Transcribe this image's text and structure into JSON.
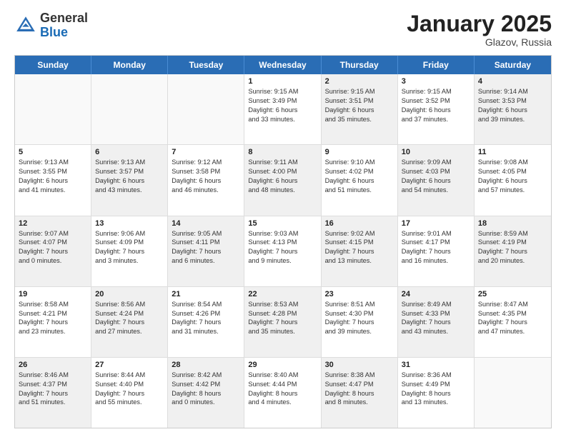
{
  "header": {
    "logo_general": "General",
    "logo_blue": "Blue",
    "title": "January 2025",
    "location": "Glazov, Russia"
  },
  "days_of_week": [
    "Sunday",
    "Monday",
    "Tuesday",
    "Wednesday",
    "Thursday",
    "Friday",
    "Saturday"
  ],
  "weeks": [
    [
      {
        "day": "",
        "lines": [],
        "empty": true
      },
      {
        "day": "",
        "lines": [],
        "empty": true
      },
      {
        "day": "",
        "lines": [],
        "empty": true
      },
      {
        "day": "1",
        "lines": [
          "Sunrise: 9:15 AM",
          "Sunset: 3:49 PM",
          "Daylight: 6 hours",
          "and 33 minutes."
        ],
        "shaded": false
      },
      {
        "day": "2",
        "lines": [
          "Sunrise: 9:15 AM",
          "Sunset: 3:51 PM",
          "Daylight: 6 hours",
          "and 35 minutes."
        ],
        "shaded": true
      },
      {
        "day": "3",
        "lines": [
          "Sunrise: 9:15 AM",
          "Sunset: 3:52 PM",
          "Daylight: 6 hours",
          "and 37 minutes."
        ],
        "shaded": false
      },
      {
        "day": "4",
        "lines": [
          "Sunrise: 9:14 AM",
          "Sunset: 3:53 PM",
          "Daylight: 6 hours",
          "and 39 minutes."
        ],
        "shaded": true
      }
    ],
    [
      {
        "day": "5",
        "lines": [
          "Sunrise: 9:13 AM",
          "Sunset: 3:55 PM",
          "Daylight: 6 hours",
          "and 41 minutes."
        ],
        "shaded": false
      },
      {
        "day": "6",
        "lines": [
          "Sunrise: 9:13 AM",
          "Sunset: 3:57 PM",
          "Daylight: 6 hours",
          "and 43 minutes."
        ],
        "shaded": true
      },
      {
        "day": "7",
        "lines": [
          "Sunrise: 9:12 AM",
          "Sunset: 3:58 PM",
          "Daylight: 6 hours",
          "and 46 minutes."
        ],
        "shaded": false
      },
      {
        "day": "8",
        "lines": [
          "Sunrise: 9:11 AM",
          "Sunset: 4:00 PM",
          "Daylight: 6 hours",
          "and 48 minutes."
        ],
        "shaded": true
      },
      {
        "day": "9",
        "lines": [
          "Sunrise: 9:10 AM",
          "Sunset: 4:02 PM",
          "Daylight: 6 hours",
          "and 51 minutes."
        ],
        "shaded": false
      },
      {
        "day": "10",
        "lines": [
          "Sunrise: 9:09 AM",
          "Sunset: 4:03 PM",
          "Daylight: 6 hours",
          "and 54 minutes."
        ],
        "shaded": true
      },
      {
        "day": "11",
        "lines": [
          "Sunrise: 9:08 AM",
          "Sunset: 4:05 PM",
          "Daylight: 6 hours",
          "and 57 minutes."
        ],
        "shaded": false
      }
    ],
    [
      {
        "day": "12",
        "lines": [
          "Sunrise: 9:07 AM",
          "Sunset: 4:07 PM",
          "Daylight: 7 hours",
          "and 0 minutes."
        ],
        "shaded": true
      },
      {
        "day": "13",
        "lines": [
          "Sunrise: 9:06 AM",
          "Sunset: 4:09 PM",
          "Daylight: 7 hours",
          "and 3 minutes."
        ],
        "shaded": false
      },
      {
        "day": "14",
        "lines": [
          "Sunrise: 9:05 AM",
          "Sunset: 4:11 PM",
          "Daylight: 7 hours",
          "and 6 minutes."
        ],
        "shaded": true
      },
      {
        "day": "15",
        "lines": [
          "Sunrise: 9:03 AM",
          "Sunset: 4:13 PM",
          "Daylight: 7 hours",
          "and 9 minutes."
        ],
        "shaded": false
      },
      {
        "day": "16",
        "lines": [
          "Sunrise: 9:02 AM",
          "Sunset: 4:15 PM",
          "Daylight: 7 hours",
          "and 13 minutes."
        ],
        "shaded": true
      },
      {
        "day": "17",
        "lines": [
          "Sunrise: 9:01 AM",
          "Sunset: 4:17 PM",
          "Daylight: 7 hours",
          "and 16 minutes."
        ],
        "shaded": false
      },
      {
        "day": "18",
        "lines": [
          "Sunrise: 8:59 AM",
          "Sunset: 4:19 PM",
          "Daylight: 7 hours",
          "and 20 minutes."
        ],
        "shaded": true
      }
    ],
    [
      {
        "day": "19",
        "lines": [
          "Sunrise: 8:58 AM",
          "Sunset: 4:21 PM",
          "Daylight: 7 hours",
          "and 23 minutes."
        ],
        "shaded": false
      },
      {
        "day": "20",
        "lines": [
          "Sunrise: 8:56 AM",
          "Sunset: 4:24 PM",
          "Daylight: 7 hours",
          "and 27 minutes."
        ],
        "shaded": true
      },
      {
        "day": "21",
        "lines": [
          "Sunrise: 8:54 AM",
          "Sunset: 4:26 PM",
          "Daylight: 7 hours",
          "and 31 minutes."
        ],
        "shaded": false
      },
      {
        "day": "22",
        "lines": [
          "Sunrise: 8:53 AM",
          "Sunset: 4:28 PM",
          "Daylight: 7 hours",
          "and 35 minutes."
        ],
        "shaded": true
      },
      {
        "day": "23",
        "lines": [
          "Sunrise: 8:51 AM",
          "Sunset: 4:30 PM",
          "Daylight: 7 hours",
          "and 39 minutes."
        ],
        "shaded": false
      },
      {
        "day": "24",
        "lines": [
          "Sunrise: 8:49 AM",
          "Sunset: 4:33 PM",
          "Daylight: 7 hours",
          "and 43 minutes."
        ],
        "shaded": true
      },
      {
        "day": "25",
        "lines": [
          "Sunrise: 8:47 AM",
          "Sunset: 4:35 PM",
          "Daylight: 7 hours",
          "and 47 minutes."
        ],
        "shaded": false
      }
    ],
    [
      {
        "day": "26",
        "lines": [
          "Sunrise: 8:46 AM",
          "Sunset: 4:37 PM",
          "Daylight: 7 hours",
          "and 51 minutes."
        ],
        "shaded": true
      },
      {
        "day": "27",
        "lines": [
          "Sunrise: 8:44 AM",
          "Sunset: 4:40 PM",
          "Daylight: 7 hours",
          "and 55 minutes."
        ],
        "shaded": false
      },
      {
        "day": "28",
        "lines": [
          "Sunrise: 8:42 AM",
          "Sunset: 4:42 PM",
          "Daylight: 8 hours",
          "and 0 minutes."
        ],
        "shaded": true
      },
      {
        "day": "29",
        "lines": [
          "Sunrise: 8:40 AM",
          "Sunset: 4:44 PM",
          "Daylight: 8 hours",
          "and 4 minutes."
        ],
        "shaded": false
      },
      {
        "day": "30",
        "lines": [
          "Sunrise: 8:38 AM",
          "Sunset: 4:47 PM",
          "Daylight: 8 hours",
          "and 8 minutes."
        ],
        "shaded": true
      },
      {
        "day": "31",
        "lines": [
          "Sunrise: 8:36 AM",
          "Sunset: 4:49 PM",
          "Daylight: 8 hours",
          "and 13 minutes."
        ],
        "shaded": false
      },
      {
        "day": "",
        "lines": [],
        "empty": true
      }
    ]
  ]
}
